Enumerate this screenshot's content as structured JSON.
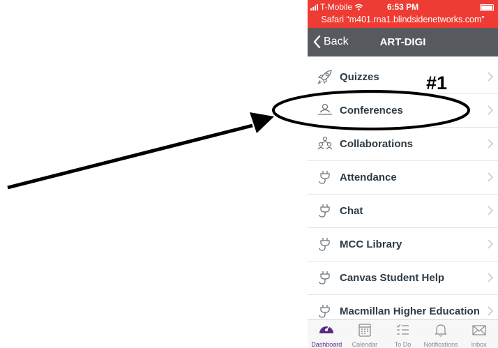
{
  "status_bar": {
    "carrier": "T-Mobile",
    "time": "6:53 PM",
    "browser_url": "Safari “m401.rna1.blindsidenetworks.com”"
  },
  "nav": {
    "back_label": "Back",
    "title": "ART-DIGI"
  },
  "menu": {
    "items": [
      {
        "label": "Quizzes",
        "icon": "rocket-icon"
      },
      {
        "label": "Conferences",
        "icon": "conference-icon"
      },
      {
        "label": "Collaborations",
        "icon": "collaborations-icon"
      },
      {
        "label": "Attendance",
        "icon": "plug-icon"
      },
      {
        "label": "Chat",
        "icon": "plug-icon"
      },
      {
        "label": "MCC Library",
        "icon": "plug-icon"
      },
      {
        "label": "Canvas Student Help",
        "icon": "plug-icon"
      },
      {
        "label": "Macmillan Higher Education",
        "icon": "plug-icon"
      }
    ]
  },
  "tabs": [
    {
      "label": "Dashboard",
      "icon": "dashboard-icon",
      "active": true
    },
    {
      "label": "Calendar",
      "icon": "calendar-icon"
    },
    {
      "label": "To Do",
      "icon": "todo-icon"
    },
    {
      "label": "Notifications",
      "icon": "bell-icon"
    },
    {
      "label": "Inbox",
      "icon": "inbox-icon"
    }
  ],
  "annotation": {
    "label": "#1"
  },
  "colors": {
    "status_red": "#ee3b33",
    "navbar_gray": "#565a5f",
    "text_dark": "#2d3b45",
    "accent_purple": "#5b2b82"
  }
}
